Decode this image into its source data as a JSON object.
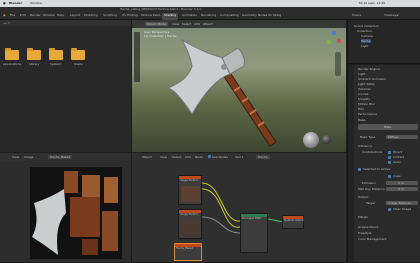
{
  "mac_menu": {
    "apple": "",
    "app": "Blender",
    "items": [
      "Window"
    ],
    "right_status": "Mi 10 sept. 12:45"
  },
  "window_title": "Hache_viking_0B000024 Texture.blend - Blender 3.4.0",
  "topbar": {
    "menus": [
      "File",
      "Edit",
      "Render",
      "Window",
      "Help"
    ],
    "workspaces": [
      "Layout",
      "Modeling",
      "Sculpting",
      "UV Editing",
      "Texture Paint",
      "Shading",
      "Animation",
      "Rendering",
      "Compositing",
      "Geometry Nodes",
      "Scripting"
    ],
    "active_workspace": "Shading",
    "scene": "Scene",
    "view_layer": "ViewLayer"
  },
  "file_browser": {
    "folders": [
      "Applications",
      "Library",
      "System",
      "Users"
    ]
  },
  "viewport": {
    "mode": "Object Mode",
    "menus": [
      "View",
      "Select",
      "Add",
      "Object"
    ],
    "label": "User Perspective",
    "collection": "(1) Collection | Hache"
  },
  "outliner": {
    "items": [
      "Scene Collection",
      "Collection",
      "Camera",
      "Hache",
      "Light"
    ]
  },
  "properties": {
    "panels": [
      "Render Engine",
      "Light",
      "Ambient Occlusion",
      "Light Paths",
      "Volumes",
      "Curves",
      "Simplify",
      "Motion Blur",
      "Film",
      "Performance",
      "Bake",
      "Grease Pencil",
      "Freestyle",
      "Color Management"
    ],
    "bake_button": "Bake",
    "bake_type_label": "Bake Type",
    "bake_type_value": "Diffuse",
    "influence_label": "Influence",
    "contributions_label": "Contributions",
    "direct": "Direct",
    "indirect": "Indirect",
    "color": "Color",
    "selected_to_active": "Selected to Active",
    "cage": "Cage",
    "extrusion_label": "Extrusion",
    "extrusion_value": "0 m",
    "max_ray_label": "Max Ray Distance",
    "max_ray_value": "0 m",
    "output_label": "Output",
    "target_label": "Target",
    "target_value": "Image Textures",
    "clear_image": "Clear Image",
    "margin_label": "Margin"
  },
  "uv_editor": {
    "menus": [
      "View",
      "Image"
    ],
    "image_name": "Hache_Baked"
  },
  "node_editor": {
    "object_label": "Object",
    "menus": [
      "View",
      "Select",
      "Add",
      "Node"
    ],
    "use_nodes": "Use Nodes",
    "slot": "Slot 1",
    "material": "Hache",
    "nodes": {
      "image_texture_1": "Image Texture",
      "image_texture_2": "Image Texture",
      "principled": "Principled BSDF",
      "material_output": "Material Output",
      "baked_image": "Hache_Baked"
    }
  },
  "colors": {
    "accent_blue": "#4b7fc1",
    "folder_orange": "#e8a93a",
    "node_header_red": "#c2471b",
    "node_header_green": "#2e7d4f"
  }
}
